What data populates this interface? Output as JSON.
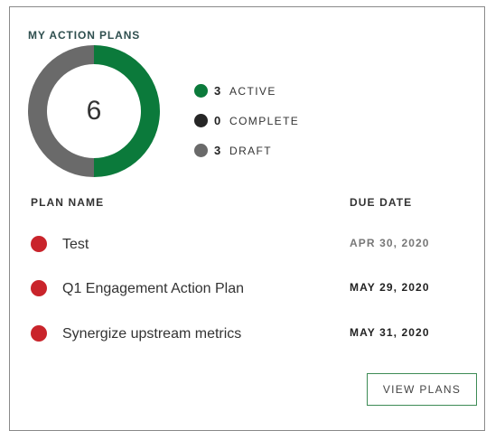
{
  "card": {
    "title": "MY ACTION PLANS",
    "total": "6"
  },
  "summary": {
    "items": [
      {
        "count": "3",
        "label": "ACTIVE",
        "value": 3,
        "color": "#0b7a3b"
      },
      {
        "count": "0",
        "label": "COMPLETE",
        "value": 0,
        "color": "#262626"
      },
      {
        "count": "3",
        "label": "DRAFT",
        "value": 3,
        "color": "#6a6a6a"
      }
    ]
  },
  "table": {
    "headers": {
      "plan": "PLAN NAME",
      "due": "DUE DATE"
    },
    "rows": [
      {
        "name": "Test",
        "due": "APR 30, 2020",
        "status_color": "#c9242b"
      },
      {
        "name": "Q1 Engagement Action Plan",
        "due": "MAY 29, 2020",
        "status_color": "#c9242b"
      },
      {
        "name": "Synergize upstream metrics",
        "due": "MAY 31, 2020",
        "status_color": "#c9242b"
      }
    ]
  },
  "actions": {
    "view_plans_label": "VIEW PLANS"
  },
  "colors": {
    "accent_green": "#0b7a3b",
    "draft_gray": "#6a6a6a",
    "overdue_red": "#c9242b"
  }
}
